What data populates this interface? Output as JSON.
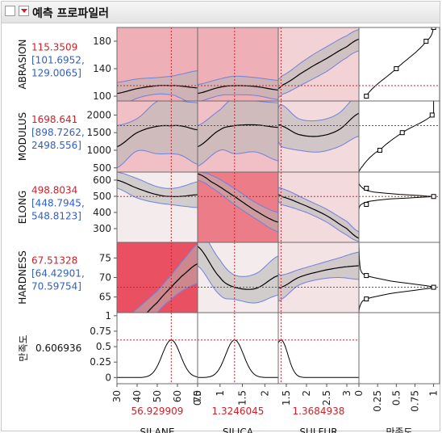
{
  "header": {
    "title": "예측 프로파일러"
  },
  "colors": {
    "curve": "#000000",
    "band_fill": "#b5b5b5",
    "band_edge": "#6f82d8",
    "crosshair": "#d0202a",
    "current_value_text": "#d0202a",
    "interval_text": "#2f5fc7",
    "desirability_marker": "#ffffff"
  },
  "chart_data": {
    "type": "line",
    "factors": [
      {
        "name": "SILANE",
        "value": "56.929909",
        "current": 56.929909,
        "range": [
          30,
          70
        ],
        "ticks": [
          "30",
          "40",
          "50",
          "60",
          "70"
        ],
        "tick_values": [
          30,
          40,
          50,
          60,
          70
        ]
      },
      {
        "name": "SILICA",
        "value": "1.3246045",
        "current": 1.3246045,
        "range": [
          0.5,
          2.3
        ],
        "ticks": [
          "0.5",
          "1",
          "1.5",
          "2"
        ],
        "tick_values": [
          0.5,
          1,
          1.5,
          2
        ]
      },
      {
        "name": "SULFUR",
        "value": "1.3684938",
        "current": 1.3684938,
        "range": [
          1.3,
          3.3
        ],
        "ticks": [
          "1.5",
          "2",
          "2.5",
          "3"
        ],
        "tick_values": [
          1.5,
          2,
          2.5,
          3
        ]
      }
    ],
    "desirability_axis": {
      "label": "만족도",
      "ticks": [
        "0",
        "0.25",
        "0.5",
        "0.75",
        "1"
      ],
      "tick_values": [
        0,
        0.25,
        0.5,
        0.75,
        1
      ],
      "range": [
        0,
        1.08
      ]
    },
    "responses": [
      {
        "name": "ABRASION",
        "value": "115.3509",
        "ci": "[101.6952,",
        "ci2": "129.0065]",
        "current": 115.3509,
        "ylim": [
          93,
          200
        ],
        "ticks": [
          "100",
          "140",
          "180"
        ],
        "tick_values": [
          100,
          140,
          180
        ],
        "curves": [
          {
            "x": [
              30,
              40,
              50,
              56.93,
              60,
              70
            ],
            "y": [
              104,
              111,
              115.2,
              115.35,
              115.1,
              112
            ],
            "lo": [
              84,
              97,
              103,
              102,
              99,
              85
            ],
            "hi": [
              120,
              125,
              127,
              129,
              131,
              137
            ],
            "shade": 0.4
          },
          {
            "x": [
              0.5,
              1,
              1.3246,
              1.8,
              2.3
            ],
            "y": [
              104,
              113,
              115.35,
              114,
              109
            ],
            "lo": [
              92,
              101,
              102,
              101,
              95
            ],
            "hi": [
              117,
              125,
              129,
              127,
              123
            ],
            "shade": 0.4
          },
          {
            "x": [
              1.3,
              1.3685,
              2,
              2.5,
              3,
              3.3
            ],
            "y": [
              111,
              115.35,
              138,
              155,
              172,
              183
            ],
            "lo": [
              98,
              102,
              120,
              136,
              156,
              166
            ],
            "hi": [
              125,
              129,
              154,
              172,
              188,
              197
            ],
            "shade": 0.2
          }
        ],
        "desirability": {
          "x": [
            100,
            140,
            180,
            200
          ],
          "d": [
            0.1,
            0.5,
            0.9,
            1.0
          ]
        },
        "current_d": 0.1
      },
      {
        "name": "MODULUS",
        "value": "1698.641",
        "ci": "[898.7262,",
        "ci2": "2498.556]",
        "current": 1698.641,
        "ylim": [
          380,
          2400
        ],
        "ticks": [
          "500",
          "1000",
          "1500",
          "2000"
        ],
        "tick_values": [
          500,
          1000,
          1500,
          2000
        ],
        "curves": [
          {
            "x": [
              30,
              40,
              50,
              56.93,
              62,
              70
            ],
            "y": [
              1100,
              1500,
              1680,
              1698.6,
              1690,
              1580
            ],
            "lo": [
              500,
              980,
              900,
              900,
              850,
              600
            ],
            "hi": [
              1700,
              1900,
              2390,
              2498,
              2400,
              2350
            ],
            "shade": 0.3
          },
          {
            "x": [
              0.5,
              1,
              1.3246,
              1.8,
              2.3
            ],
            "y": [
              1100,
              1580,
              1698.6,
              1720,
              1650
            ],
            "lo": [
              550,
              1000,
              900,
              950,
              700
            ],
            "hi": [
              1700,
              2150,
              2498,
              2400,
              2350
            ],
            "shade": 0.3
          },
          {
            "x": [
              1.3,
              1.3685,
              1.8,
              2.3,
              2.8,
              3.3
            ],
            "y": [
              1720,
              1698.6,
              1450,
              1400,
              1580,
              2050
            ],
            "lo": [
              1250,
              1100,
              1000,
              950,
              1100,
              1400
            ],
            "hi": [
              2200,
              2300,
              1900,
              1850,
              2050,
              2600
            ],
            "shade": 0.15
          }
        ],
        "desirability": {
          "x": [
            380,
            550,
            800,
            1000,
            1500,
            2000,
            2400
          ],
          "d": [
            0.0,
            0.05,
            0.15,
            0.28,
            0.58,
            0.98,
            1.0
          ]
        },
        "current_d": 0.6
      },
      {
        "name": "ELONG",
        "value": "498.8034",
        "ci": "[448.7945,",
        "ci2": "548.8123]",
        "current": 498.8034,
        "ylim": [
          215,
          650
        ],
        "ticks": [
          "300",
          "400",
          "500",
          "600"
        ],
        "tick_values": [
          300,
          400,
          500,
          600
        ],
        "curves": [
          {
            "x": [
              30,
              40,
              50,
              56.93,
              62,
              70
            ],
            "y": [
              600,
              550,
              510,
              498.8,
              500,
              510
            ],
            "lo": [
              550,
              490,
              460,
              448.8,
              440,
              430
            ],
            "hi": [
              650,
              610,
              560,
              548.8,
              560,
              590
            ],
            "shade": 0.05
          },
          {
            "x": [
              0.5,
              0.8,
              1.3246,
              1.8,
              2.3
            ],
            "y": [
              640,
              590,
              498.8,
              410,
              340
            ],
            "lo": [
              600,
              555,
              448.8,
              360,
              280
            ],
            "hi": [
              650,
              630,
              548.8,
              460,
              400
            ],
            "shade": 0.7
          },
          {
            "x": [
              1.3,
              1.3685,
              2,
              2.5,
              3,
              3.3
            ],
            "y": [
              510,
              498.8,
              440,
              380,
              300,
              240
            ],
            "lo": [
              470,
              448.8,
              400,
              340,
              260,
              220
            ],
            "hi": [
              550,
              548.8,
              480,
              420,
              345,
              280
            ],
            "shade": 0.15
          }
        ],
        "desirability": {
          "x": [
            215,
            420,
            450,
            470,
            485,
            493,
            498.8,
            505,
            515,
            530,
            550,
            580,
            650
          ],
          "d": [
            0,
            0,
            0.03,
            0.15,
            0.45,
            0.8,
            1.0,
            0.8,
            0.45,
            0.15,
            0.05,
            0,
            0
          ]
        },
        "current_d": 0.9
      },
      {
        "name": "HARDNESS",
        "value": "67.51328",
        "ci": "[64.42901,",
        "ci2": "70.59754]",
        "current": 67.51328,
        "ylim": [
          61,
          79
        ],
        "ticks": [
          "65",
          "70",
          "75"
        ],
        "tick_values": [
          65,
          70,
          75
        ],
        "curves": [
          {
            "x": [
              30,
              40,
              50,
              56.93,
              62,
              70
            ],
            "y": [
              55,
              58.5,
              63.6,
              67.5,
              70.3,
              73.5
            ],
            "lo": [
              52,
              55,
              61,
              64.4,
              66.5,
              68.5
            ],
            "hi": [
              58,
              62,
              66.5,
              70.6,
              74,
              78.5
            ],
            "shade": 0.95
          },
          {
            "x": [
              0.5,
              1,
              1.3246,
              1.8,
              2.3
            ],
            "y": [
              78,
              70,
              67.5,
              67.2,
              70.5
            ],
            "lo": [
              73,
              65.5,
              64.4,
              63.5,
              65.5
            ],
            "hi": [
              83,
              74.5,
              70.6,
              71,
              75.5
            ],
            "shade": 0.05
          },
          {
            "x": [
              1.3,
              1.3685,
              1.8,
              2.3,
              2.8,
              3.3
            ],
            "y": [
              67.5,
              67.5,
              70,
              71.5,
              72.5,
              73
            ],
            "lo": [
              64,
              64.4,
              68,
              69.5,
              70,
              69.5
            ],
            "hi": [
              71,
              70.6,
              72,
              73.5,
              75,
              76.5
            ],
            "shade": 0.1
          }
        ],
        "desirability": {
          "x": [
            61,
            63,
            64.5,
            66,
            67,
            67.5,
            68,
            69,
            70.5,
            72,
            79
          ],
          "d": [
            0,
            0.02,
            0.1,
            0.45,
            0.85,
            1.0,
            0.85,
            0.45,
            0.1,
            0.02,
            0
          ]
        },
        "current_d": 0.9
      }
    ],
    "overall_desirability": {
      "label": "만족도",
      "value": "0.606936",
      "current": 0.606936,
      "ylim": [
        -0.1,
        1.05
      ],
      "ticks": [
        "0",
        "0.25",
        "0.5",
        "0.75",
        "1"
      ],
      "tick_values": [
        0,
        0.25,
        0.5,
        0.75,
        1
      ],
      "curves": [
        {
          "center": 56.93,
          "width": 4.5,
          "peak": 0.606936
        },
        {
          "center": 1.3246,
          "width": 0.2,
          "peak": 0.606936
        },
        {
          "center": 1.3685,
          "width": 0.17,
          "peak": 0.606936
        }
      ]
    }
  }
}
